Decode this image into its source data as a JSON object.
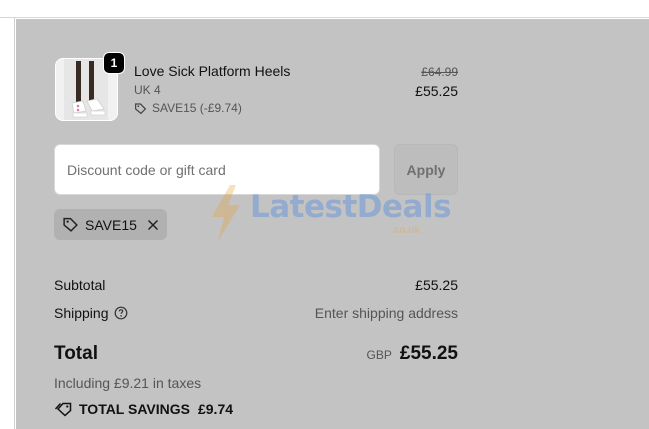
{
  "product": {
    "quantity": "1",
    "name": "Love Sick Platform Heels",
    "variant": "UK 4",
    "discount_line": "SAVE15 (-£9.74)",
    "price_original": "£64.99",
    "price_final": "£55.25"
  },
  "discount": {
    "placeholder": "Discount code or gift card",
    "apply_label": "Apply",
    "applied_code": "SAVE15"
  },
  "watermark": {
    "brand": "LatestDeals",
    "sub": ".co.uk"
  },
  "summary": {
    "subtotal_label": "Subtotal",
    "subtotal_value": "£55.25",
    "shipping_label": "Shipping",
    "shipping_value": "Enter shipping address",
    "total_label": "Total",
    "currency": "GBP",
    "total_value": "£55.25",
    "taxes_note": "Including £9.21 in taxes",
    "savings_label": "TOTAL SAVINGS",
    "savings_value": "£9.74"
  },
  "colors": {
    "panel_bg": "#c3c3c3",
    "chip_bg": "#b1b1b1",
    "watermark_blue": "#2d7be5",
    "watermark_orange": "#e7a035"
  }
}
